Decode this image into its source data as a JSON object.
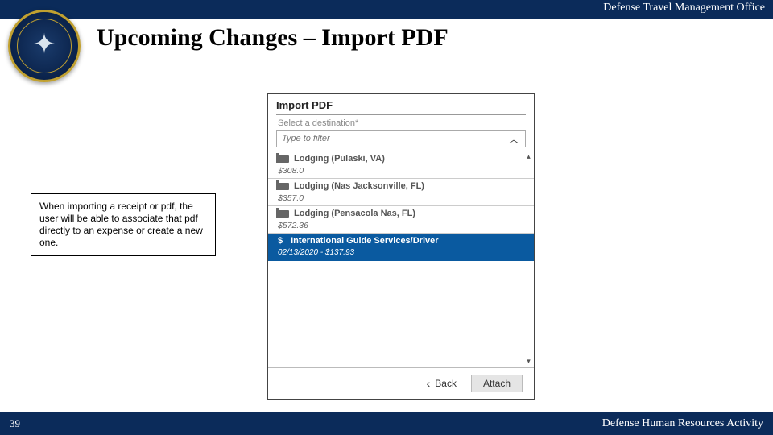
{
  "header": {
    "org": "Defense Travel Management Office"
  },
  "title": "Upcoming Changes – Import PDF",
  "callout": "When importing a receipt or pdf, the user will be able to associate that pdf directly to an expense or create a new one.",
  "panel": {
    "heading": "Import PDF",
    "field_label": "Select a destination*",
    "filter_placeholder": "Type to filter",
    "items": [
      {
        "title": "Lodging (Pulaski, VA)",
        "price": "$308.0"
      },
      {
        "title": "Lodging (Nas Jacksonville, FL)",
        "price": "$357.0"
      },
      {
        "title": "Lodging (Pensacola Nas, FL)",
        "price": "$572.36"
      }
    ],
    "selected": {
      "title": "International Guide Services/Driver",
      "sub": "02/13/2020 - $137.93"
    },
    "back_label": "Back",
    "attach_label": "Attach"
  },
  "footer": {
    "page": "39",
    "org": "Defense Human Resources Activity"
  }
}
